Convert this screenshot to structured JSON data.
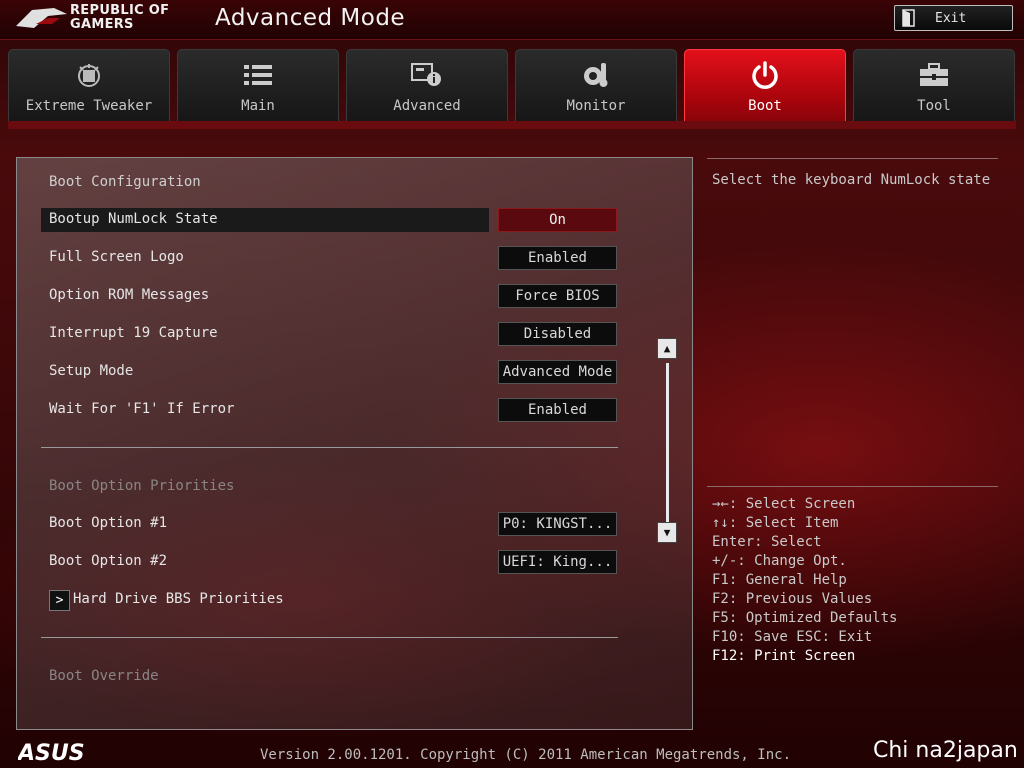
{
  "header": {
    "brand_line1": "REPUBLIC OF",
    "brand_line2": "GAMERS",
    "mode_title": "Advanced Mode",
    "exit_label": "Exit",
    "exit_icon": "exit-door-icon"
  },
  "tabs": [
    {
      "label": "Extreme Tweaker",
      "icon": "tweaker-chip-icon",
      "active": false
    },
    {
      "label": "Main",
      "icon": "list-icon",
      "active": false
    },
    {
      "label": "Advanced",
      "icon": "advanced-info-icon",
      "active": false
    },
    {
      "label": "Monitor",
      "icon": "thermometer-gear-icon",
      "active": false
    },
    {
      "label": "Boot",
      "icon": "power-icon",
      "active": true
    },
    {
      "label": "Tool",
      "icon": "toolbox-icon",
      "active": false
    }
  ],
  "main": {
    "boot_configuration_title": "Boot Configuration",
    "rows": [
      {
        "label": "Bootup NumLock State",
        "value": "On"
      },
      {
        "label": "Full Screen Logo",
        "value": "Enabled"
      },
      {
        "label": "Option ROM Messages",
        "value": "Force BIOS"
      },
      {
        "label": "Interrupt 19 Capture",
        "value": "Disabled"
      },
      {
        "label": "Setup Mode",
        "value": "Advanced Mode"
      },
      {
        "label": "Wait For 'F1' If Error",
        "value": "Enabled"
      }
    ],
    "boot_priorities_title": "Boot Option Priorities",
    "priority_rows": [
      {
        "label": "Boot Option #1",
        "value": "P0: KINGST..."
      },
      {
        "label": "Boot Option #2",
        "value": "UEFI: King..."
      }
    ],
    "hdd_submenu": "Hard Drive BBS Priorities",
    "boot_override_title": "Boot Override"
  },
  "help": {
    "description": "Select the keyboard NumLock state",
    "keys": [
      "→←: Select Screen",
      "↑↓: Select Item",
      "Enter: Select",
      "+/-: Change Opt.",
      "F1: General Help",
      "F2: Previous Values",
      "F5: Optimized Defaults",
      "F10: Save  ESC: Exit",
      "F12: Print Screen"
    ]
  },
  "footer": {
    "logo": "ASUS",
    "version": "Version 2.00.1201. Copyright (C) 2011 American Megatrends, Inc.",
    "watermark": "Chi na2japan"
  },
  "colors": {
    "accent_red": "#d10a14",
    "selected_value_bg": "#5a0a0e"
  }
}
